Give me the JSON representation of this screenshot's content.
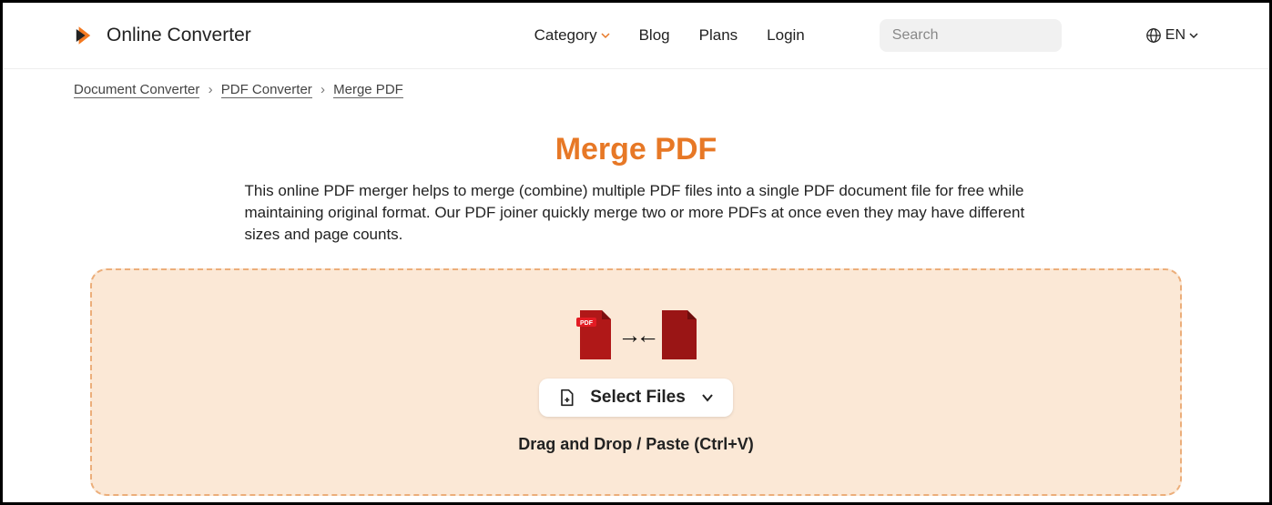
{
  "header": {
    "brand": "Online Converter",
    "nav": {
      "category": "Category",
      "blog": "Blog",
      "plans": "Plans",
      "login": "Login"
    },
    "search_placeholder": "Search",
    "lang": "EN"
  },
  "breadcrumb": {
    "level1": "Document Converter",
    "level2": "PDF Converter",
    "level3": "Merge PDF"
  },
  "main": {
    "title": "Merge PDF",
    "description": "This online PDF merger helps to merge (combine) multiple PDF files into a single PDF document file for free while maintaining original format. Our PDF joiner quickly merge two or more PDFs at once even they may have different sizes and page counts.",
    "pdf_badge": "PDF",
    "select_label": "Select Files",
    "drag_hint": "Drag and Drop / Paste (Ctrl+V)"
  }
}
